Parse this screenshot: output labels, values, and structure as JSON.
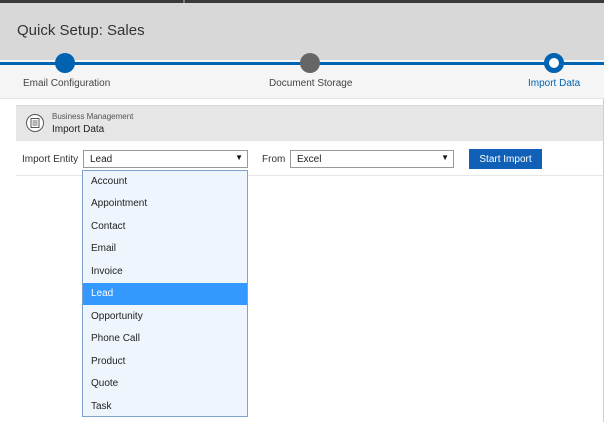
{
  "header": {
    "title": "Quick Setup: Sales"
  },
  "steps": [
    {
      "label": "Email Configuration",
      "state": "done"
    },
    {
      "label": "Document Storage",
      "state": "pending"
    },
    {
      "label": "Import Data",
      "state": "active"
    }
  ],
  "section": {
    "subtitle": "Business Management",
    "heading": "Import Data",
    "icon": "list-document-icon"
  },
  "form": {
    "entity_label": "Import Entity",
    "entity_value": "Lead",
    "from_label": "From",
    "from_value": "Excel",
    "start_button": "Start Import"
  },
  "dropdown": {
    "options": [
      "Account",
      "Appointment",
      "Contact",
      "Email",
      "Invoice",
      "Lead",
      "Opportunity",
      "Phone Call",
      "Product",
      "Quote",
      "Task"
    ],
    "selected": "Lead"
  },
  "colors": {
    "accent": "#1160b7",
    "step_done": "#0063b1",
    "step_pending": "#666666",
    "highlight": "#3399ff"
  }
}
